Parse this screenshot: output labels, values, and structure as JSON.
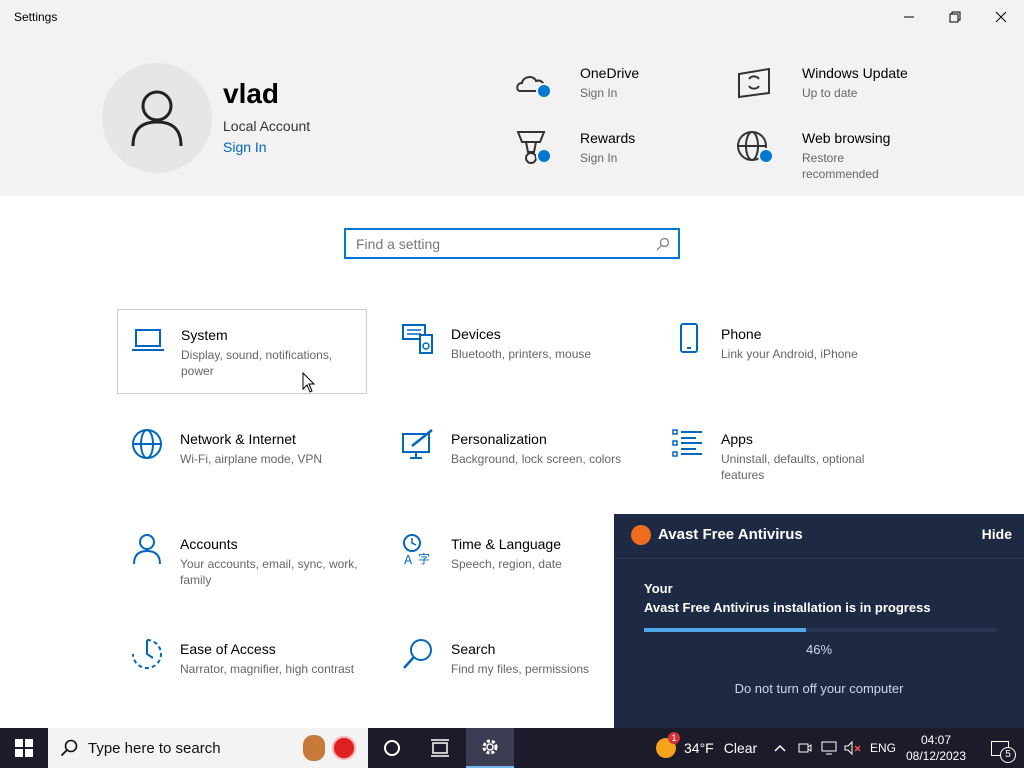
{
  "window": {
    "title": "Settings",
    "controls": {
      "minimize": "minimize",
      "restore": "restore",
      "close": "close"
    }
  },
  "account": {
    "name": "vlad",
    "type": "Local Account",
    "sign_in": "Sign In"
  },
  "services": [
    {
      "title": "OneDrive",
      "subtitle": "Sign In",
      "icon": "cloud-icon"
    },
    {
      "title": "Windows Update",
      "subtitle": "Up to date",
      "icon": "update-icon"
    },
    {
      "title": "Rewards",
      "subtitle": "Sign In",
      "icon": "trophy-icon"
    },
    {
      "title": "Web browsing",
      "subtitle": "Restore recommended",
      "icon": "globe-icon"
    }
  ],
  "search": {
    "placeholder": "Find a setting"
  },
  "categories": [
    {
      "title": "System",
      "subtitle": "Display, sound, notifications, power",
      "icon": "laptop-icon"
    },
    {
      "title": "Devices",
      "subtitle": "Bluetooth, printers, mouse",
      "icon": "devices-icon"
    },
    {
      "title": "Phone",
      "subtitle": "Link your Android, iPhone",
      "icon": "phone-icon"
    },
    {
      "title": "Network & Internet",
      "subtitle": "Wi-Fi, airplane mode, VPN",
      "icon": "globe-icon"
    },
    {
      "title": "Personalization",
      "subtitle": "Background, lock screen, colors",
      "icon": "paintbrush-icon"
    },
    {
      "title": "Apps",
      "subtitle": "Uninstall, defaults, optional features",
      "icon": "apps-list-icon"
    },
    {
      "title": "Accounts",
      "subtitle": "Your accounts, email, sync, work, family",
      "icon": "person-icon"
    },
    {
      "title": "Time & Language",
      "subtitle": "Speech, region, date",
      "icon": "time-language-icon"
    },
    {
      "title": "Ease of Access",
      "subtitle": "Narrator, magnifier, high contrast",
      "icon": "ease-of-access-icon"
    },
    {
      "title": "Search",
      "subtitle": "Find my files, permissions",
      "icon": "search-icon"
    }
  ],
  "avast": {
    "name": "Avast Free Antivirus",
    "hide": "Hide",
    "line1": "Your",
    "line2": "Avast Free Antivirus installation is in progress",
    "progress": 0.46,
    "percent": "46%",
    "note": "Do not turn off your computer"
  },
  "taskbar": {
    "search_placeholder": "Type here to search",
    "weather_temp": "34°F",
    "weather_text": "Clear",
    "weather_badge": "1",
    "language": "ENG",
    "time": "04:07",
    "date": "08/12/2023",
    "notification_count": "5"
  },
  "colors": {
    "accent": "#0078d4",
    "header_bg": "#f2f2f2",
    "avast_bg": "#1e2a44",
    "taskbar_bg": "#1b1b2a"
  }
}
